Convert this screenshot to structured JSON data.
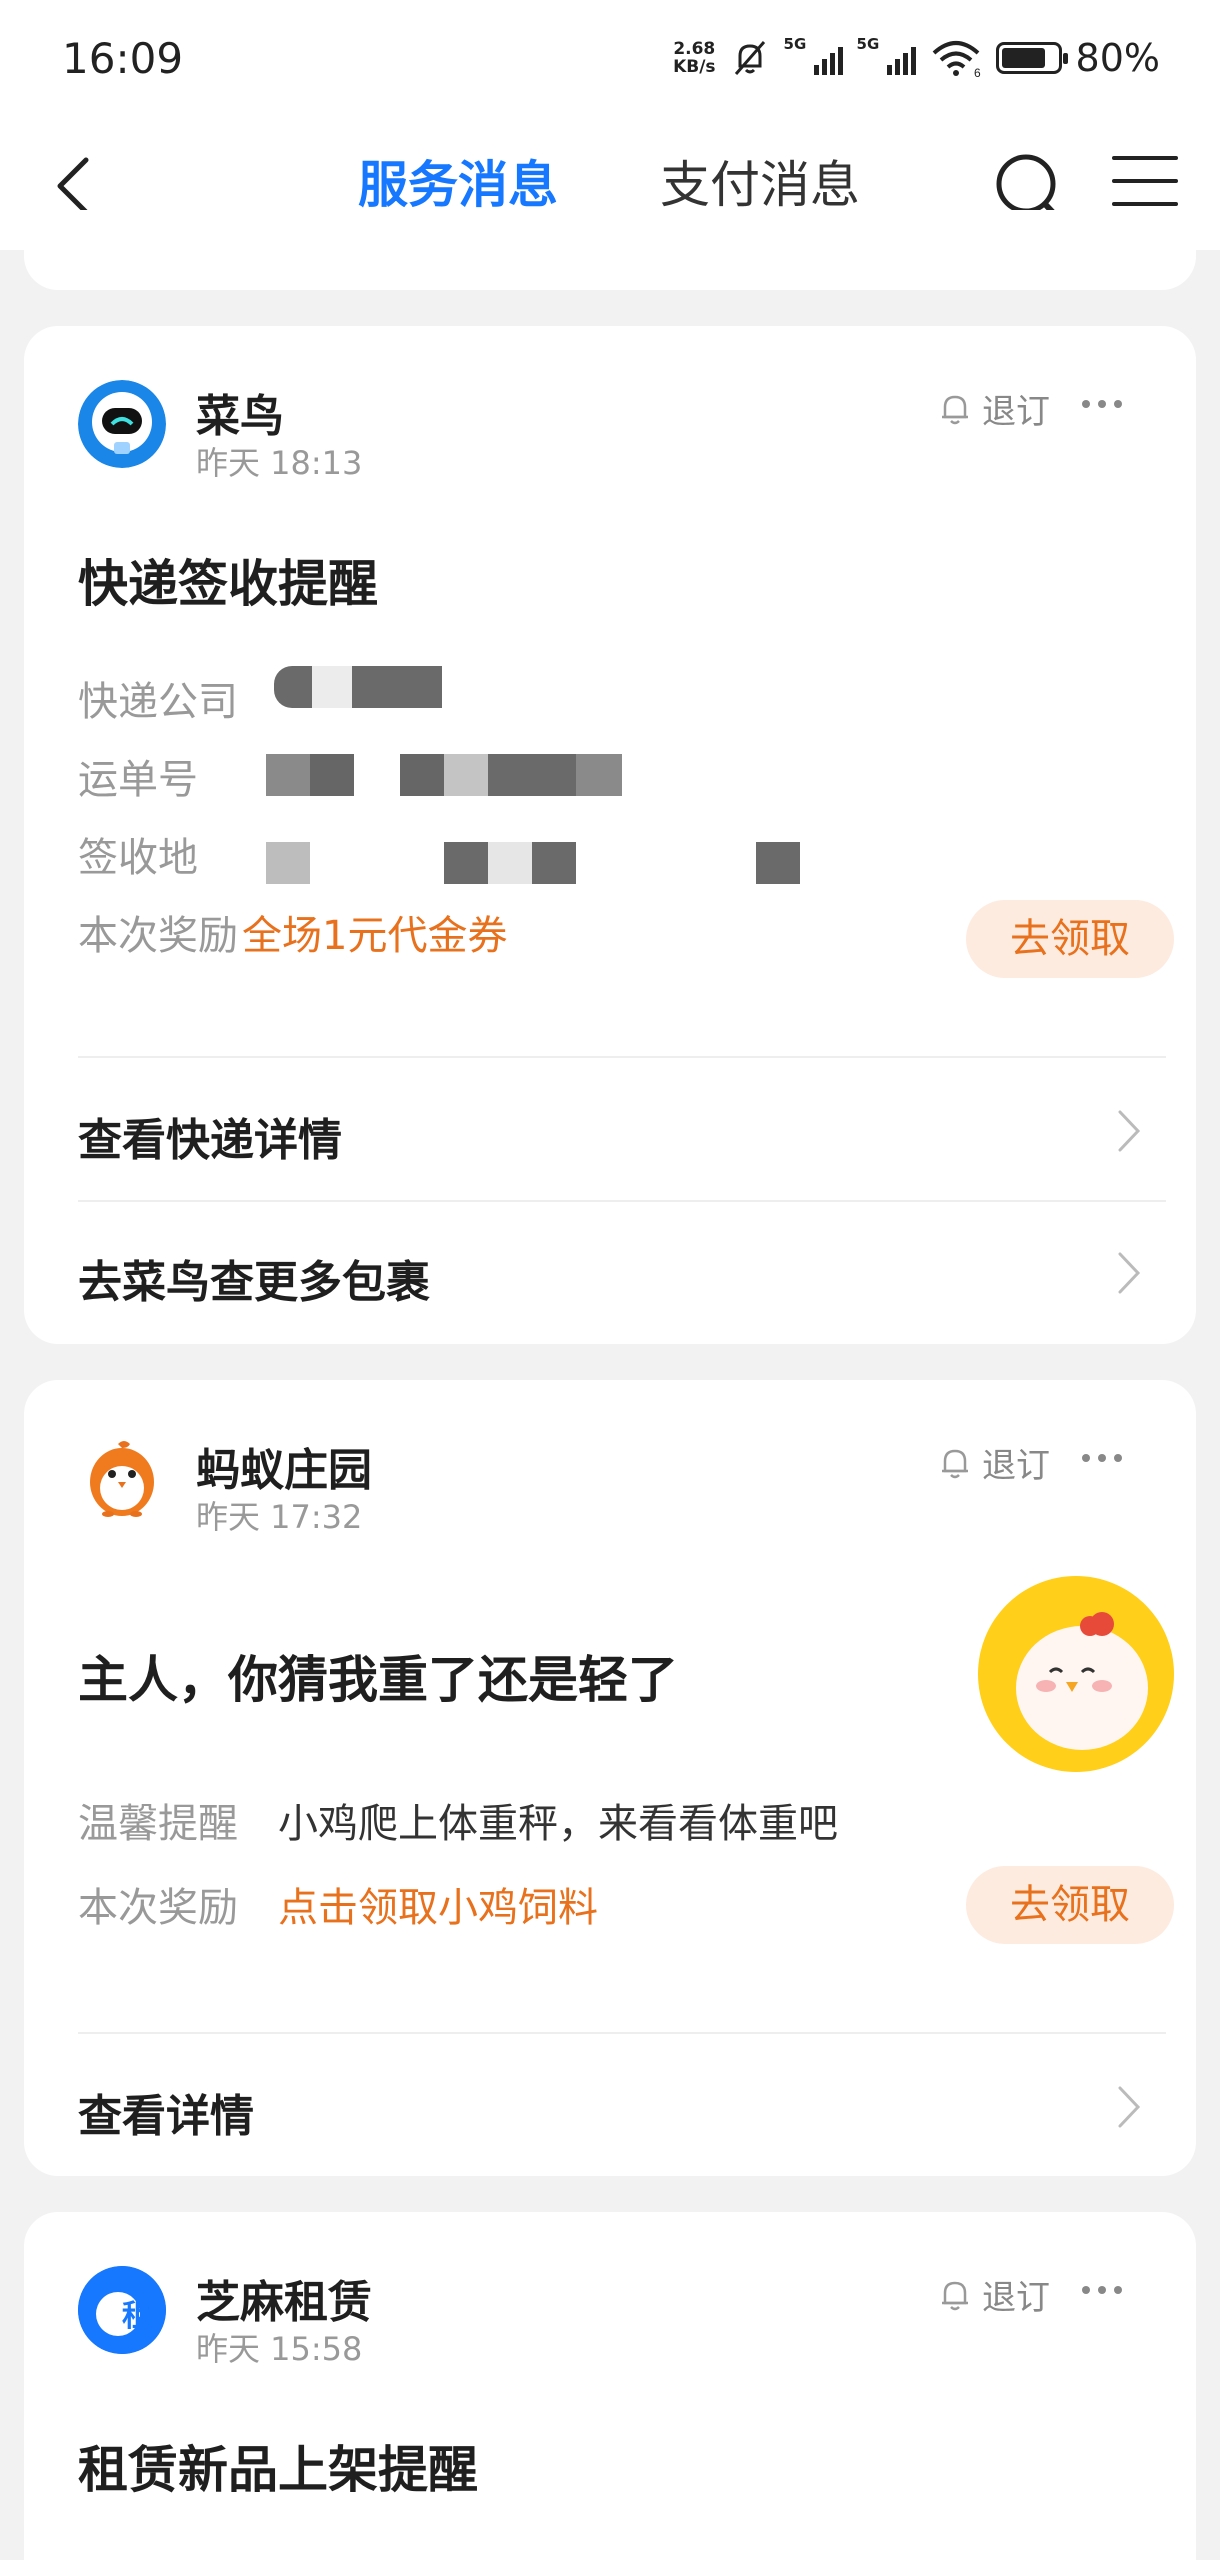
{
  "status_bar": {
    "time": "16:09",
    "net_speed_value": "2.68",
    "net_speed_unit": "KB/s",
    "signal_1_label": "5G",
    "signal_2_label": "5G",
    "wifi_sub": "6",
    "battery_percent": "80%",
    "battery_level": 0.8
  },
  "header": {
    "tab_service": "服务消息",
    "tab_payment": "支付消息"
  },
  "cards": {
    "cainiao": {
      "source": "菜鸟",
      "time": "昨天 18:13",
      "unsubscribe": "退订",
      "title": "快递签收提醒",
      "fields": {
        "company_key": "快递公司",
        "tracking_key": "运单号",
        "location_key": "签收地",
        "reward_key": "本次奖励",
        "reward_value": "全场1元代金券"
      },
      "claim_button": "去领取",
      "link_1": "查看快递详情",
      "link_2": "去菜鸟查更多包裹"
    },
    "antfarm": {
      "source": "蚂蚁庄园",
      "time": "昨天 17:32",
      "unsubscribe": "退订",
      "title": "主人，你猜我重了还是轻了",
      "fields": {
        "tip_key": "温馨提醒",
        "tip_value": "小鸡爬上体重秤，来看看体重吧",
        "reward_key": "本次奖励",
        "reward_value": "点击领取小鸡饲料"
      },
      "claim_button": "去领取",
      "link_1": "查看详情"
    },
    "zhima": {
      "source": "芝麻租赁",
      "time": "昨天 15:58",
      "unsubscribe": "退订",
      "title": "租赁新品上架提醒",
      "logo_char": "租"
    }
  },
  "colors": {
    "accent_blue": "#1677ff",
    "reward_orange": "#e8711d",
    "claim_bg": "#fdebe0"
  }
}
